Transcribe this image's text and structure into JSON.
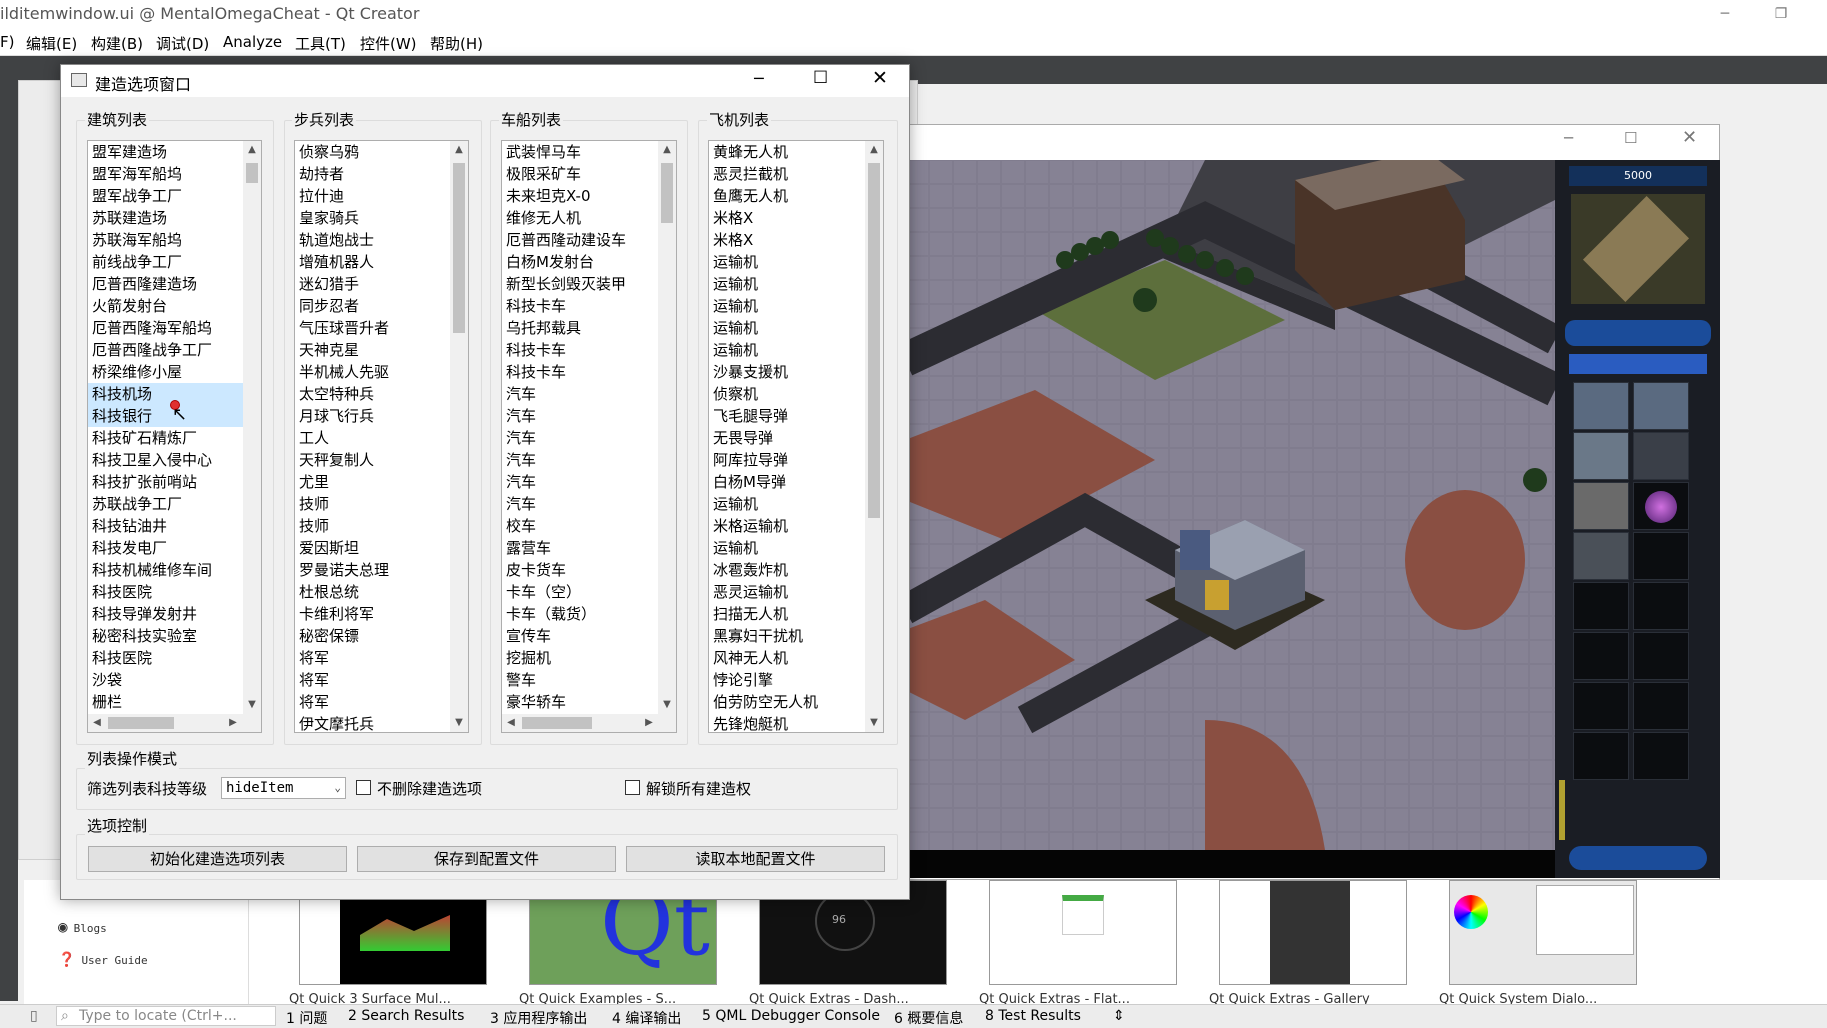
{
  "qt": {
    "title": "ilditemwindow.ui @ MentalOmegaCheat - Qt Creator",
    "menu": [
      "F)",
      "编辑(E)",
      "构建(B)",
      "调试(D)",
      "Analyze",
      "工具(T)",
      "控件(W)",
      "帮助(H)"
    ],
    "welcome_links": [
      "Blogs",
      "User Guide"
    ],
    "thumbnails": [
      "Qt Quick 3 Surface Mul...",
      "Qt Quick Examples - S...",
      "Qt Quick Extras - Dash...",
      "Qt Quick Extras - Flat...",
      "Qt Quick Extras - Gallery",
      "Qt Quick System Dialo..."
    ],
    "locate_placeholder": "Type to locate (Ctrl+...",
    "status_tabs": [
      "1 问题",
      "2 Search Results",
      "3 应用程序输出",
      "4 编译输出",
      "5 QML Debugger Console",
      "6 概要信息",
      "8 Test Results"
    ]
  },
  "dialog": {
    "title": "建造选项窗口",
    "lists": [
      {
        "label": "建筑列表",
        "items": [
          "盟军建造场",
          "盟军海军船坞",
          "盟军战争工厂",
          "苏联建造场",
          "苏联海军船坞",
          "前线战争工厂",
          "厄普西隆建造场",
          "火箭发射台",
          "厄普西隆海军船坞",
          "厄普西隆战争工厂",
          "桥梁维修小屋",
          "科技机场",
          "科技银行",
          "科技矿石精炼厂",
          "科技卫星入侵中心",
          "科技扩张前哨站",
          "苏联战争工厂",
          "科技钻油井",
          "科技发电厂",
          "科技机械维修车间",
          "科技医院",
          "科技导弹发射井",
          "秘密科技实验室",
          "科技医院",
          "沙袋",
          "栅栏"
        ]
      },
      {
        "label": "步兵列表",
        "items": [
          "侦察乌鸦",
          "劫持者",
          "拉什迪",
          "皇家骑兵",
          "轨道炮战士",
          "增殖机器人",
          "迷幻猎手",
          "同步忍者",
          "气压球晋升者",
          "天神克星",
          "半机械人先驱",
          "太空特种兵",
          "月球飞行兵",
          "工人",
          "天秤复制人",
          "尤里",
          "技师",
          "技师",
          "爱因斯坦",
          "罗曼诺夫总理",
          "杜根总统",
          "卡维利将军",
          "秘密保镖",
          "将军",
          "将军",
          "将军",
          "伊文摩托兵"
        ]
      },
      {
        "label": "车船列表",
        "items": [
          "武装悍马车",
          "极限采矿车",
          "未来坦克X-0",
          "维修无人机",
          "厄普西隆动建设车",
          "白杨M发射台",
          "新型长剑毁灭装甲",
          "科技卡车",
          "乌托邦载具",
          "科技卡车",
          "科技卡车",
          "汽车",
          "汽车",
          "汽车",
          "汽车",
          "汽车",
          "汽车",
          "校车",
          "露营车",
          "皮卡货车",
          "卡车（空）",
          "卡车（载货）",
          "宣传车",
          "挖掘机",
          "警车",
          "豪华轿车"
        ]
      },
      {
        "label": "飞机列表",
        "items": [
          "黄蜂无人机",
          "恶灵拦截机",
          "鱼鹰无人机",
          "米格X",
          "米格X",
          "运输机",
          "运输机",
          "运输机",
          "运输机",
          "运输机",
          "沙暴支援机",
          "侦察机",
          "飞毛腿导弹",
          "无畏导弹",
          "阿库拉导弹",
          "白杨M导弹",
          "运输机",
          "米格运输机",
          "运输机",
          "冰雹轰炸机",
          "恶灵运输机",
          "扫描无人机",
          "黑寡妇干扰机",
          "风神无人机",
          "悖论引擎",
          "伯劳防空无人机",
          "先锋炮艇机"
        ]
      }
    ],
    "mode_group": "列表操作模式",
    "filter_label": "筛选列表科技等级",
    "filter_value": "hideItem",
    "keep_label": "不删除建造选项",
    "unlock_label": "解锁所有建造权",
    "control_group": "选项控制",
    "buttons": [
      "初始化建造选项列表",
      "保存到配置文件",
      "读取本地配置文件"
    ]
  },
  "game": {
    "credits": "5000"
  }
}
